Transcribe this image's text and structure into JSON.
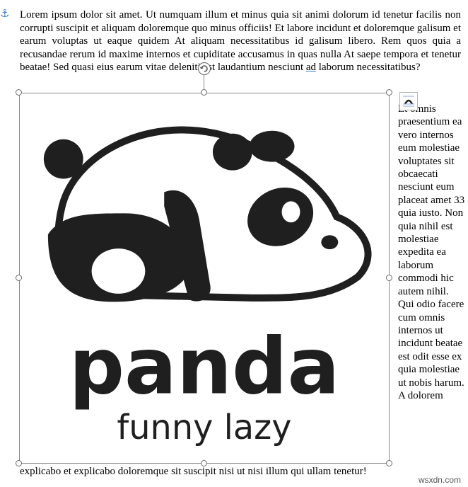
{
  "doc": {
    "paragraph_top": "Lorem ipsum dolor sit amet. Ut numquam illum et minus quia sit animi dolorum id tenetur facilis non corrupti suscipit et aliquam doloremque quo minus officiis! Et labore incidunt et doloremque galisum et earum voluptas ut eaque quidem At aliquam necessitatibus id galisum libero. Rem quos quia a recusandae rerum id maxime internos et cupiditate accusamus in quas nulla At saepe tempora et tenetur beatae! Sed quasi eius earum vitae deleniti est laudantium nesciunt",
    "word_ad": "ad",
    "word_laborum": "laborum",
    "word_end": "necessitatibus?",
    "wrap_column": "Et omnis praesentium ea vero internos eum molestiae voluptates sit obcaecati nesciunt eum placeat amet 33 quia iusto. Non quia nihil est molestiae expedita ea laborum commodi hic autem nihil. Qui odio facere cum omnis internos ut incidunt beatae est odit esse ex quia molestiae ut nobis harum. A dolorem",
    "paragraph_bottom": "explicabo et explicabo doloremque sit suscipit nisi ut nisi illum qui ullam tenetur!"
  },
  "logo": {
    "wordmark": "panda",
    "tagline": "funny lazy"
  },
  "icons": {
    "anchor": "anchor-icon",
    "layout_options": "layout-options-icon",
    "rotate": "rotate-handle-icon"
  },
  "watermark": "wsxdn.com"
}
